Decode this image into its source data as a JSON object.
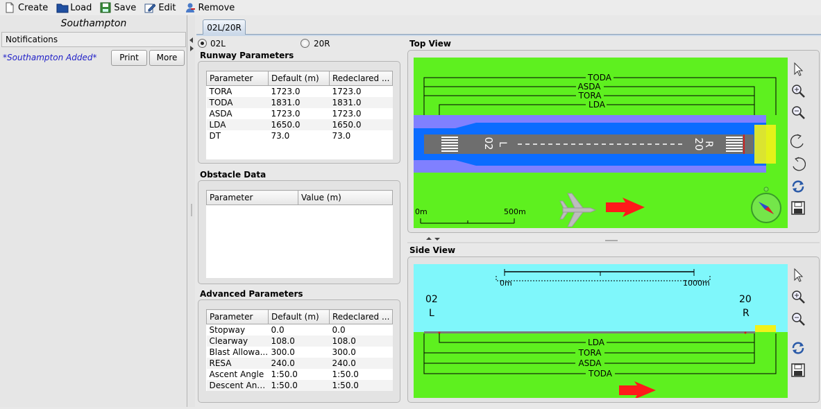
{
  "menu": {
    "create": "Create",
    "load": "Load",
    "save": "Save",
    "edit": "Edit",
    "remove": "Remove"
  },
  "left": {
    "airport": "Southampton",
    "notifications_header": "Notifications",
    "notification": "*Southampton Added*",
    "print": "Print",
    "more": "More"
  },
  "tab": {
    "label": "02L/20R"
  },
  "runway_select": {
    "left": "02L",
    "right": "20R",
    "selected": "02L"
  },
  "runway_params": {
    "title": "Runway Parameters",
    "headers": [
      "Parameter",
      "Default (m)",
      "Redeclared ..."
    ],
    "rows": [
      [
        "TORA",
        "1723.0",
        "1723.0"
      ],
      [
        "TODA",
        "1831.0",
        "1831.0"
      ],
      [
        "ASDA",
        "1723.0",
        "1723.0"
      ],
      [
        "LDA",
        "1650.0",
        "1650.0"
      ],
      [
        "DT",
        "73.0",
        "73.0"
      ]
    ]
  },
  "obstacle": {
    "title": "Obstacle Data",
    "headers": [
      "Parameter",
      "Value (m)"
    ]
  },
  "advanced": {
    "title": "Advanced Parameters",
    "headers": [
      "Parameter",
      "Default (m)",
      "Redeclared ..."
    ],
    "rows": [
      [
        "Stopway",
        "0.0",
        "0.0"
      ],
      [
        "Clearway",
        "108.0",
        "108.0"
      ],
      [
        "Blast Allowa...",
        "300.0",
        "300.0"
      ],
      [
        "RESA",
        "240.0",
        "240.0"
      ],
      [
        "Ascent Angle",
        "1:50.0",
        "1:50.0"
      ],
      [
        "Descent Ang...",
        "1:50.0",
        "1:50.0"
      ]
    ]
  },
  "top_view": {
    "title": "Top View",
    "labels": {
      "toda": "TODA",
      "asda": "ASDA",
      "tora": "TORA",
      "lda": "LDA"
    },
    "designator_left": "02",
    "designator_left_letter": "L",
    "designator_right": "20",
    "designator_right_letter": "R",
    "scale_start": "0m",
    "scale_end": "500m"
  },
  "side_view": {
    "title": "Side View",
    "labels": {
      "toda": "TODA",
      "asda": "ASDA",
      "tora": "TORA",
      "lda": "LDA"
    },
    "left_num": "02",
    "left_letter": "L",
    "right_num": "20",
    "right_letter": "R",
    "scale_start": "0m",
    "scale_end": "1000m"
  },
  "colors": {
    "grass": "#5ef01f",
    "sky": "#7ff7fb",
    "clearway": "#8080ff",
    "runway_strip": "#0b6cff",
    "runway": "#6e6e6e",
    "stopway": "#f2f21a",
    "arrow": "#ff1a1a"
  },
  "icons": {
    "create": "new-file-icon",
    "load": "folder-icon",
    "save": "floppy-disk-icon",
    "edit": "pencil-icon",
    "remove": "remove-user-icon",
    "pointer": "pointer-icon",
    "zoom_in": "zoom-in-icon",
    "zoom_out": "zoom-out-icon",
    "rotate_left": "rotate-left-icon",
    "rotate_right": "rotate-right-icon",
    "refresh": "refresh-icon",
    "save_view": "floppy-disk-icon",
    "compass": "compass-icon",
    "plane": "plane-icon",
    "arrow": "direction-arrow-icon"
  }
}
